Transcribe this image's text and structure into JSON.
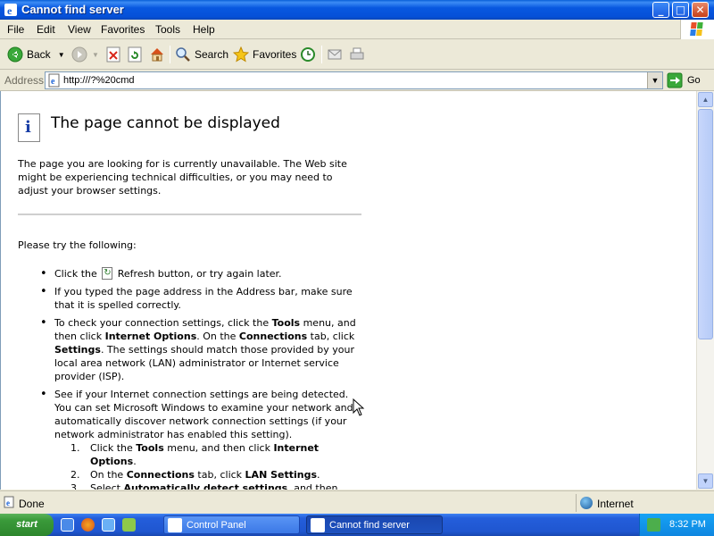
{
  "window": {
    "title": "Cannot find server",
    "controls": {
      "minimize": "_",
      "maximize": "□",
      "close": "✕"
    }
  },
  "menubar": {
    "items": [
      {
        "label": "File"
      },
      {
        "label": "Edit"
      },
      {
        "label": "View"
      },
      {
        "label": "Favorites"
      },
      {
        "label": "Tools"
      },
      {
        "label": "Help"
      }
    ]
  },
  "toolbar": {
    "back_label": "Back",
    "search_label": "Search",
    "favorites_label": "Favorites"
  },
  "address": {
    "label": "Address",
    "value": "http:///?%20cmd",
    "go_label": "Go"
  },
  "page": {
    "title": "The page cannot be displayed",
    "intro": "The page you are looking for is currently unavailable. The Web site might be experiencing technical difficulties, or you may need to adjust your browser settings.",
    "try_heading": "Please try the following:",
    "bullets": {
      "b1_pre": "Click the",
      "b1_post": "Refresh button, or try again later.",
      "b2": "If you typed the page address in the Address bar, make sure that it is spelled correctly.",
      "b3_a": "To check your connection settings, click the ",
      "b3_tools": "Tools",
      "b3_b": " menu, and then click ",
      "b3_options": "Internet Options",
      "b3_c": ". On the ",
      "b3_connections": "Connections",
      "b3_d": " tab, click ",
      "b3_settings": "Settings",
      "b3_e": ". The settings should match those provided by your local area network (LAN) administrator or Internet service provider (ISP).",
      "b4": "See if your Internet connection settings are being detected. You can set Microsoft Windows to examine your network and automatically discover network connection settings (if your network administrator has enabled this setting)."
    },
    "steps": {
      "s1_num": "1.",
      "s1_a": "Click the ",
      "s1_tools": "Tools",
      "s1_b": " menu, and then click ",
      "s1_options": "Internet Options",
      "s1_c": ".",
      "s2_num": "2.",
      "s2_a": "On the ",
      "s2_connections": "Connections",
      "s2_b": " tab, click ",
      "s2_lan": "LAN Settings",
      "s2_c": ".",
      "s3_num": "3.",
      "s3_a": "Select ",
      "s3_auto": "Automatically detect settings",
      "s3_b": ", and then"
    }
  },
  "status": {
    "text": "Done",
    "zone": "Internet"
  },
  "taskbar": {
    "start_label": "start",
    "tasks": [
      {
        "label": "Control Panel"
      },
      {
        "label": "Cannot find server"
      }
    ],
    "clock": "8:32 PM"
  },
  "colors": {
    "title_bar": "#0554d8",
    "taskbar": "#245edb",
    "start_button": "#3a9a3a",
    "tray": "#0e86e0"
  }
}
